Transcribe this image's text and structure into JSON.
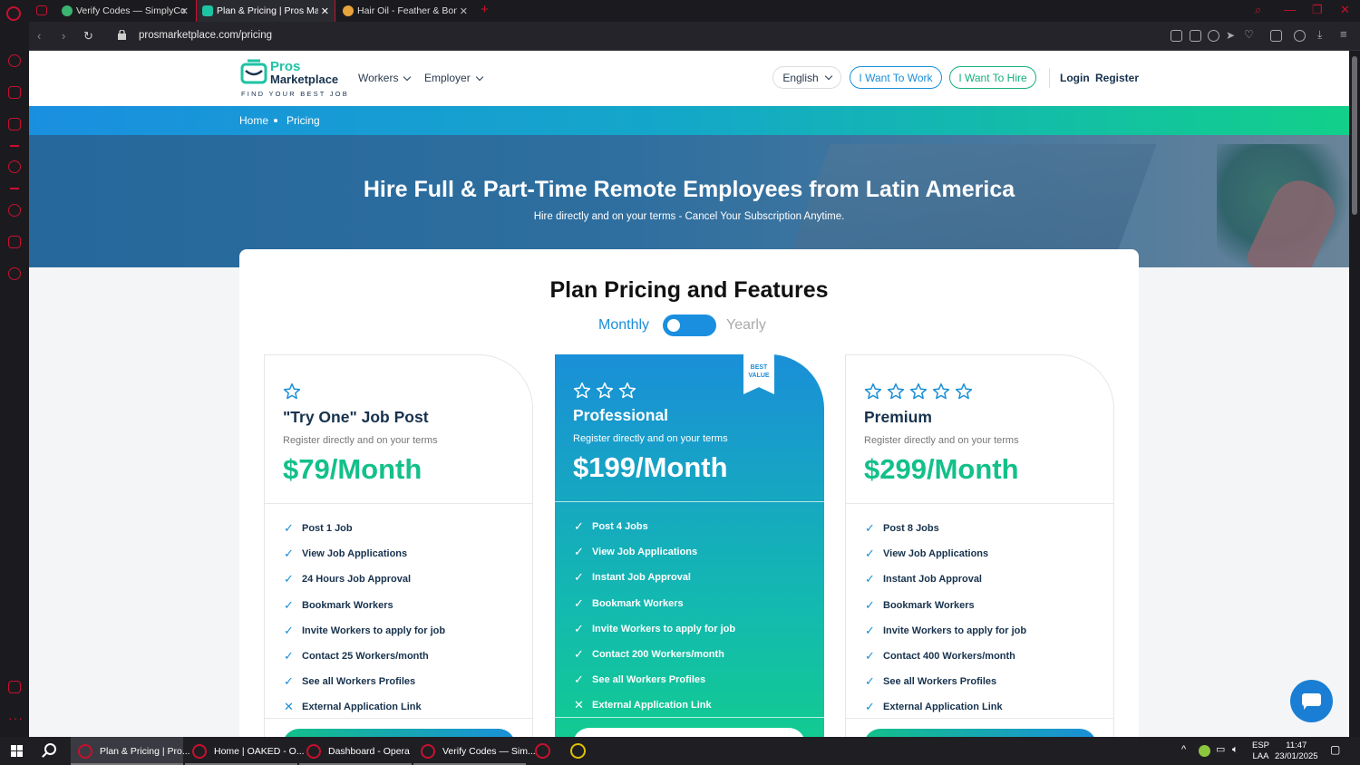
{
  "browser": {
    "tabs": [
      {
        "label": "Verify Codes — SimplyCodes",
        "active": false
      },
      {
        "label": "Plan & Pricing | Pros Marketplace",
        "active": true
      },
      {
        "label": "Hair Oil - Feather & Bone S",
        "active": false
      }
    ],
    "url": "prosmarketplace.com/pricing",
    "accent_color": "#c8102e"
  },
  "site": {
    "logo": {
      "line1": "Pros",
      "line2": "Marketplace",
      "tagline": "FIND YOUR BEST JOB"
    },
    "nav": {
      "workers": "Workers",
      "employer": "Employer"
    },
    "language": "English",
    "want_to_work": "I Want To Work",
    "want_to_hire": "I Want To Hire",
    "login": "Login",
    "register": "Register"
  },
  "breadcrumb": {
    "home": "Home",
    "current": "Pricing"
  },
  "hero": {
    "title": "Hire Full & Part-Time Remote Employees from Latin America",
    "subtitle": "Hire directly and on your terms - Cancel Your Subscription Anytime."
  },
  "pricing": {
    "heading": "Plan Pricing and Features",
    "monthly_label": "Monthly",
    "yearly_label": "Yearly",
    "toggle_selected": "Monthly",
    "plans": [
      {
        "stars": 1,
        "title": "\"Try One\" Job Post",
        "desc": "Register directly and on your terms",
        "price": "$79/Month",
        "featured": false,
        "features": [
          {
            "text": "Post 1 Job",
            "included": true
          },
          {
            "text": "View Job Applications",
            "included": true
          },
          {
            "text": "24 Hours Job Approval",
            "included": true
          },
          {
            "text": "Bookmark Workers",
            "included": true
          },
          {
            "text": "Invite Workers to apply for job",
            "included": true
          },
          {
            "text": "Contact 25 Workers/month",
            "included": true
          },
          {
            "text": "See all Workers Profiles",
            "included": true
          },
          {
            "text": "External Application Link",
            "included": false
          }
        ]
      },
      {
        "stars": 3,
        "title": "Professional",
        "desc": "Register directly and on your terms",
        "price": "$199/Month",
        "featured": true,
        "ribbon": "BEST VALUE",
        "features": [
          {
            "text": "Post 4 Jobs",
            "included": true
          },
          {
            "text": "View Job Applications",
            "included": true
          },
          {
            "text": "Instant Job Approval",
            "included": true
          },
          {
            "text": "Bookmark Workers",
            "included": true
          },
          {
            "text": "Invite Workers to apply for job",
            "included": true
          },
          {
            "text": "Contact 200 Workers/month",
            "included": true
          },
          {
            "text": "See all Workers Profiles",
            "included": true
          },
          {
            "text": "External Application Link",
            "included": false
          }
        ]
      },
      {
        "stars": 5,
        "title": "Premium",
        "desc": "Register directly and on your terms",
        "price": "$299/Month",
        "featured": false,
        "features": [
          {
            "text": "Post 8 Jobs",
            "included": true
          },
          {
            "text": "View Job Applications",
            "included": true
          },
          {
            "text": "Instant Job Approval",
            "included": true
          },
          {
            "text": "Bookmark Workers",
            "included": true
          },
          {
            "text": "Invite Workers to apply for job",
            "included": true
          },
          {
            "text": "Contact 400 Workers/month",
            "included": true
          },
          {
            "text": "See all Workers Profiles",
            "included": true
          },
          {
            "text": "External Application Link",
            "included": true
          }
        ]
      }
    ]
  },
  "taskbar": {
    "items": [
      {
        "label": "Plan & Pricing | Pro...",
        "active": true
      },
      {
        "label": "Home | OAKED - O...",
        "active": false
      },
      {
        "label": "Dashboard - Opera",
        "active": false
      },
      {
        "label": "Verify Codes — Sim...",
        "active": false
      }
    ],
    "lang_top": "ESP",
    "lang_bottom": "LAA",
    "time": "11:47",
    "date": "23/01/2025"
  },
  "colors": {
    "brand_green": "#13c08a",
    "brand_blue": "#1a8fd8",
    "navy": "#17324d"
  }
}
